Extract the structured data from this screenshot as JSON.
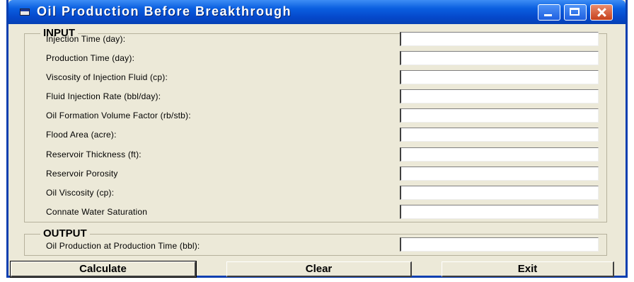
{
  "window": {
    "title": "Oil Production Before Breakthrough"
  },
  "input_group": {
    "legend": "INPUT",
    "fields": [
      {
        "label": "Injection Time (day):",
        "value": ""
      },
      {
        "label": "Production Time (day):",
        "value": ""
      },
      {
        "label": "Viscosity of Injection Fluid (cp):",
        "value": ""
      },
      {
        "label": "Fluid Injection Rate (bbl/day):",
        "value": ""
      },
      {
        "label": "Oil Formation Volume Factor (rb/stb):",
        "value": ""
      },
      {
        "label": "Flood Area (acre):",
        "value": ""
      },
      {
        "label": "Reservoir Thickness (ft):",
        "value": ""
      },
      {
        "label": "Reservoir Porosity",
        "value": ""
      },
      {
        "label": "Oil Viscosity (cp):",
        "value": ""
      },
      {
        "label": "Connate Water Saturation",
        "value": ""
      }
    ]
  },
  "output_group": {
    "legend": "OUTPUT",
    "label": "Oil Production at Production Time (bbl):",
    "value": ""
  },
  "buttons": {
    "calculate": "Calculate",
    "clear": "Clear",
    "exit": "Exit"
  },
  "icons": {
    "window_icon": "app-icon",
    "minimize": "minimize-icon",
    "maximize": "maximize-icon",
    "close": "close-icon"
  }
}
